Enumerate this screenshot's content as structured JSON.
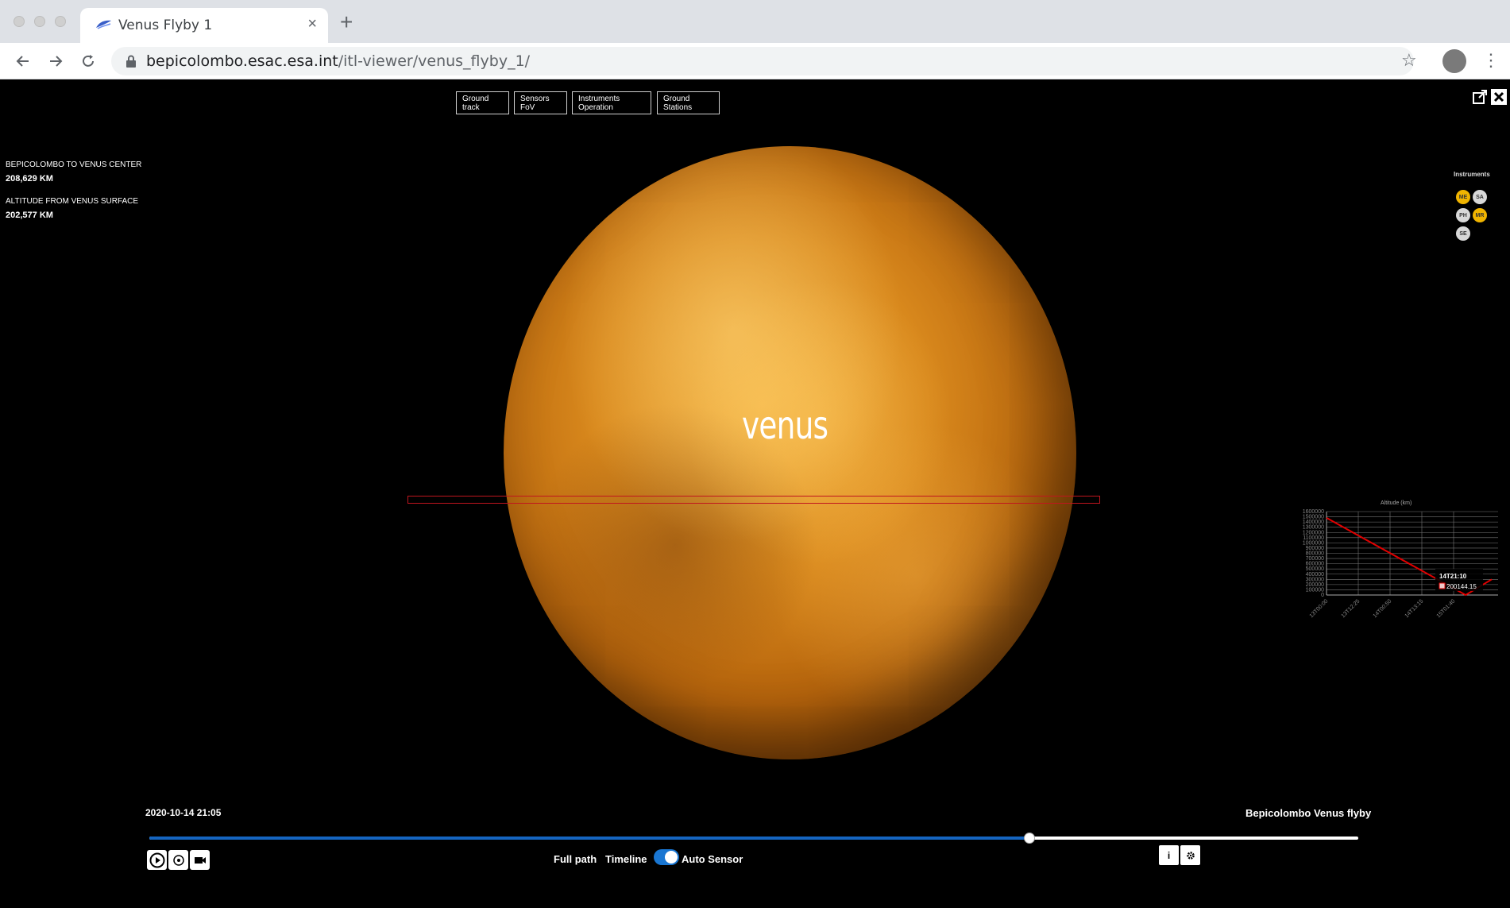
{
  "browser": {
    "tab_title": "Venus Flyby 1",
    "url_host": "bepicolombo.esac.esa.int",
    "url_path": "/itl-viewer/venus_flyby_1/"
  },
  "top_buttons": [
    "Ground track",
    "Sensors FoV",
    "Instruments Operation",
    "Ground Stations"
  ],
  "info": {
    "distance_label": "BEPICOLOMBO TO VENUS CENTER",
    "distance_value": "208,629 KM",
    "altitude_label": "ALTITUDE FROM VENUS SURFACE",
    "altitude_value": "202,577 KM"
  },
  "instruments": {
    "title": "Instruments",
    "items": [
      {
        "code": "ME",
        "active": true,
        "color": "#f0b400"
      },
      {
        "code": "SA",
        "active": false,
        "color": "#d8d8d8"
      },
      {
        "code": "PH",
        "active": false,
        "color": "#d8d8d8"
      },
      {
        "code": "MR",
        "active": true,
        "color": "#f0b400"
      },
      {
        "code": "SE",
        "active": false,
        "color": "#d8d8d8"
      }
    ]
  },
  "planet_label": "venus",
  "chart_data": {
    "type": "line",
    "title": "Altitude (km)",
    "ylim": [
      0,
      1600000
    ],
    "yticks": [
      0,
      100000,
      200000,
      300000,
      400000,
      500000,
      600000,
      700000,
      800000,
      900000,
      1000000,
      1100000,
      1200000,
      1300000,
      1400000,
      1500000,
      1600000
    ],
    "xticks": [
      "13T00:00",
      "13T12:25",
      "14T00:50",
      "14T13:15",
      "15T01:40"
    ],
    "series": [
      {
        "x": [
          0,
          4.38,
          5.2
        ],
        "y": [
          1480000,
          0,
          300000
        ],
        "color": "#e00000"
      }
    ],
    "tooltip": {
      "time": "14T21:10",
      "value": "200144.15"
    },
    "grid": true
  },
  "timeline": {
    "datetime": "2020-10-14 21:05",
    "mission": "Bepicolombo Venus flyby",
    "progress": 0.728
  },
  "controls": {
    "full_path": "Full path",
    "timeline": "Timeline",
    "auto_sensor": "Auto Sensor",
    "info_btn": "i"
  }
}
